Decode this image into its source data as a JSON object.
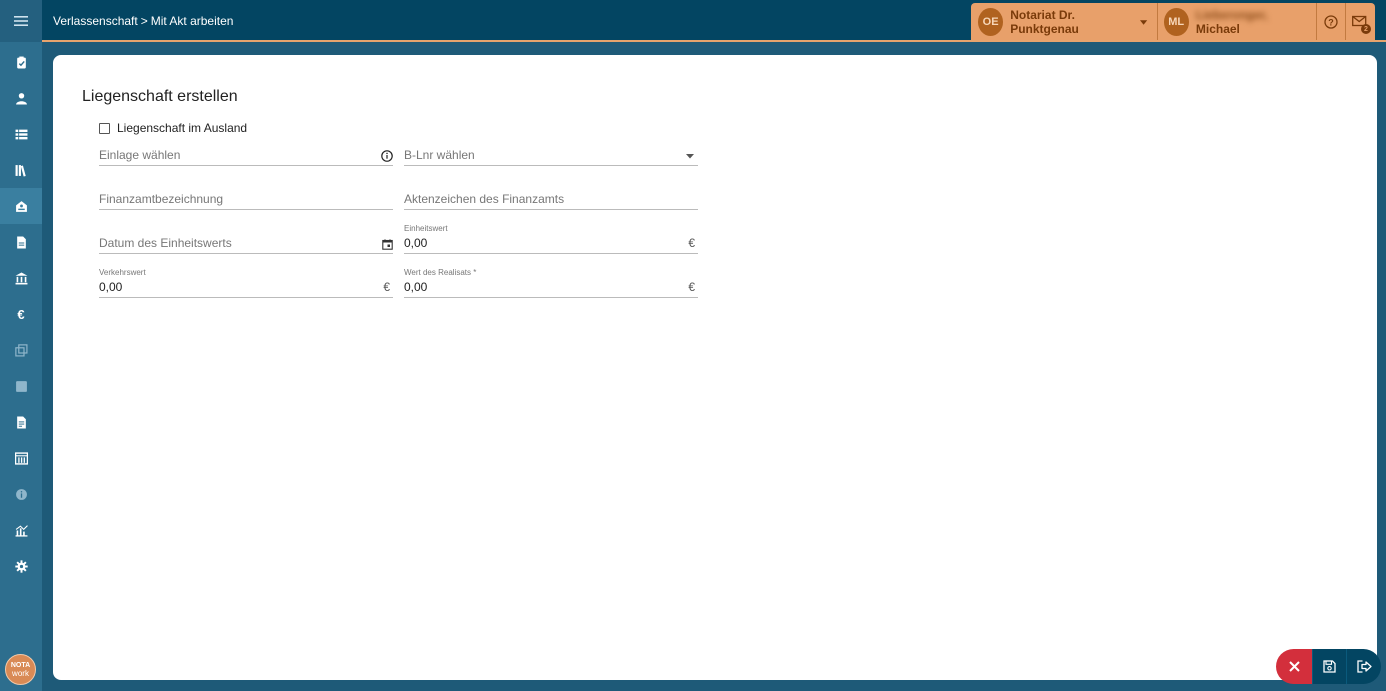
{
  "breadcrumb": {
    "first": "Verlassenschaft",
    "separator": ">",
    "second": "Mit Akt arbeiten"
  },
  "org": {
    "initials": "OE",
    "name": "Notariat Dr. Punktgenau"
  },
  "user": {
    "initials": "ML",
    "last_name": "Lieberonger,",
    "first_name": "Michael"
  },
  "notifications": {
    "count": "2"
  },
  "logo": {
    "line1": "NOTA",
    "line2": "work"
  },
  "form": {
    "title": "Liegenschaft erstellen",
    "checkbox_label": "Liegenschaft im Ausland",
    "einlage_placeholder": "Einlage wählen",
    "blnr_placeholder": "B-Lnr wählen",
    "finanzamt_placeholder": "Finanzamtbezeichnung",
    "aktenzeichen_placeholder": "Aktenzeichen des Finanzamts",
    "datum_placeholder": "Datum des Einheitswerts",
    "einheitswert_label": "Einheitswert",
    "einheitswert_value": "0,00",
    "verkehrswert_label": "Verkehrswert",
    "verkehrswert_value": "0,00",
    "realisat_label": "Wert des Realisats *",
    "realisat_value": "0,00",
    "currency": "€"
  },
  "colors": {
    "topbar": "#034562",
    "sidebar": "#2d6e8e",
    "accent": "#e8a06a",
    "cancel": "#d32f3c"
  },
  "sidebar_icons": [
    "clipboard-check-icon",
    "person-icon",
    "list-icon",
    "library-icon",
    "estate-icon",
    "document-icon",
    "bank-icon",
    "euro-icon",
    "copy-icon",
    "square-icon",
    "file-icon",
    "calendar-grid-icon",
    "info-icon",
    "chart-icon",
    "gear-icon"
  ]
}
